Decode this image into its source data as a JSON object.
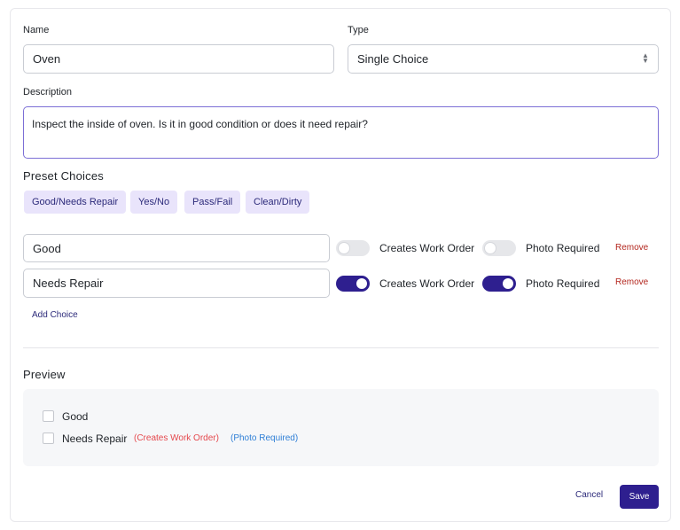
{
  "form": {
    "name_label": "Name",
    "name_value": "Oven",
    "type_label": "Type",
    "type_value": "Single Choice",
    "description_label": "Description",
    "description_value": "Inspect the inside of oven. Is it in good condition or does it need repair?"
  },
  "presets": {
    "title": "Preset Choices",
    "items": [
      "Good/Needs Repair",
      "Yes/No",
      "Pass/Fail",
      "Clean/Dirty"
    ]
  },
  "choices": {
    "items": [
      {
        "value": "Good",
        "creates_work_order": false,
        "photo_required": false
      },
      {
        "value": "Needs Repair",
        "creates_work_order": true,
        "photo_required": true
      }
    ],
    "creates_work_order_label": "Creates Work Order",
    "photo_required_label": "Photo Required",
    "remove_label": "Remove",
    "add_choice_label": "Add Choice"
  },
  "preview": {
    "title": "Preview",
    "items": [
      "Good",
      "Needs Repair"
    ],
    "creates_work_order_tag": "(Creates Work Order)",
    "photo_required_tag": "(Photo Required)"
  },
  "actions": {
    "cancel_label": "Cancel",
    "save_label": "Save"
  },
  "colors": {
    "accent": "#2e1f8f",
    "preset_bg": "#e9e4fb",
    "remove": "#b3261e",
    "work_order_tag": "#e5484d",
    "photo_tag": "#2f7fd6"
  },
  "icons": {
    "type_select": "chevron-up-down-icon"
  }
}
